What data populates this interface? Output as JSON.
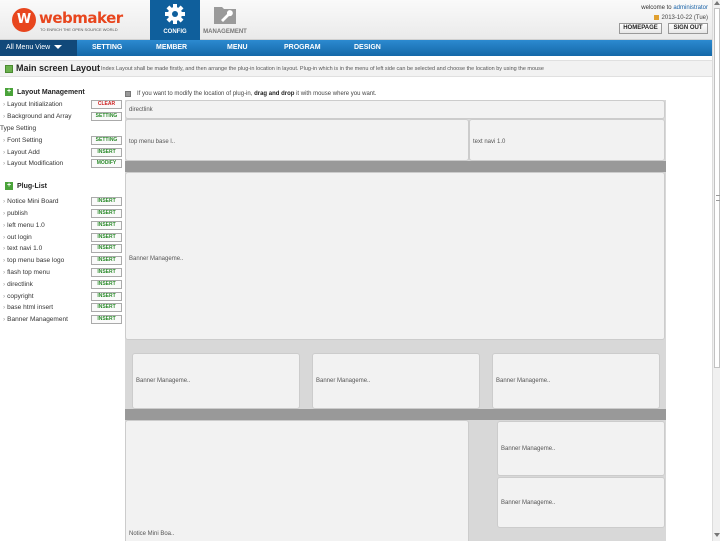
{
  "header": {
    "logo_mark": "W",
    "logo_brand": "webmaker",
    "logo_tagline": "TO ENRICH THE OPEN SOURCE WORLD",
    "tabs": [
      {
        "label": "CONFIG",
        "active": true
      },
      {
        "label": "MANAGEMENT",
        "active": false
      }
    ],
    "welcome_prefix": "welcome to",
    "welcome_user": "administrator",
    "date": "2013-10-22 (Tue)",
    "homepage_label": "HOMEPAGE",
    "signout_label": "SIGN OUT"
  },
  "nav": {
    "all_menu_label": "All Menu View",
    "items": [
      "SETTING",
      "MEMBER",
      "MENU",
      "PROGRAM",
      "DESIGN"
    ]
  },
  "page": {
    "title": "Main screen Layout",
    "description": "Index Layout shall be made firstly, and then arrange the plug-in location in layout. Plug-in which is in the menu of left side can be selected and choose the location by using the mouse"
  },
  "sidebar": {
    "layout_management": {
      "heading": "Layout Management",
      "rows": [
        {
          "label": "Layout Initialization",
          "button": "CLEAR"
        },
        {
          "label": "Background and Array",
          "button": "SETTING"
        },
        {
          "label": "Type Setting",
          "button": ""
        },
        {
          "label": "Font Setting",
          "button": "SETTING"
        },
        {
          "label": "Layout Add",
          "button": "INSERT"
        },
        {
          "label": "Layout Modification",
          "button": "MODIFY"
        }
      ]
    },
    "plug_list": {
      "heading": "Plug-List",
      "rows": [
        {
          "label": "Notice Mini Board",
          "button": "INSERT"
        },
        {
          "label": "publish",
          "button": "INSERT"
        },
        {
          "label": "left menu 1.0",
          "button": "INSERT"
        },
        {
          "label": "out login",
          "button": "INSERT"
        },
        {
          "label": "text navi 1.0",
          "button": "INSERT"
        },
        {
          "label": "top menu base logo",
          "button": "INSERT"
        },
        {
          "label": "flash top menu",
          "button": "INSERT"
        },
        {
          "label": "directlink",
          "button": "INSERT"
        },
        {
          "label": "copyright",
          "button": "INSERT"
        },
        {
          "label": "base html insert",
          "button": "INSERT"
        },
        {
          "label": "Banner Management",
          "button": "INSERT"
        }
      ]
    }
  },
  "hint": {
    "prefix": "If you want to modify the location of plug-in,",
    "emphasis": "drag and drop",
    "suffix": "it with mouse where you want."
  },
  "layout_blocks": {
    "directlink": "directlink",
    "top_menu": "top menu base l..",
    "text_navi": "text navi 1.0",
    "banner_large": "Banner Manageme..",
    "banner_a": "Banner Manageme..",
    "banner_b": "Banner Manageme..",
    "banner_c": "Banner Manageme..",
    "notice": "Notice Mini Boa..",
    "banner_right_top": "Banner Manageme..",
    "banner_right_bottom": "Banner Manageme.."
  },
  "colors": {
    "nav_blue": "#1a73b8",
    "active_tab": "#0f5f9c",
    "logo_orange": "#e8461e",
    "insert_green": "#2a8a2a",
    "clear_red": "#cc2020"
  }
}
